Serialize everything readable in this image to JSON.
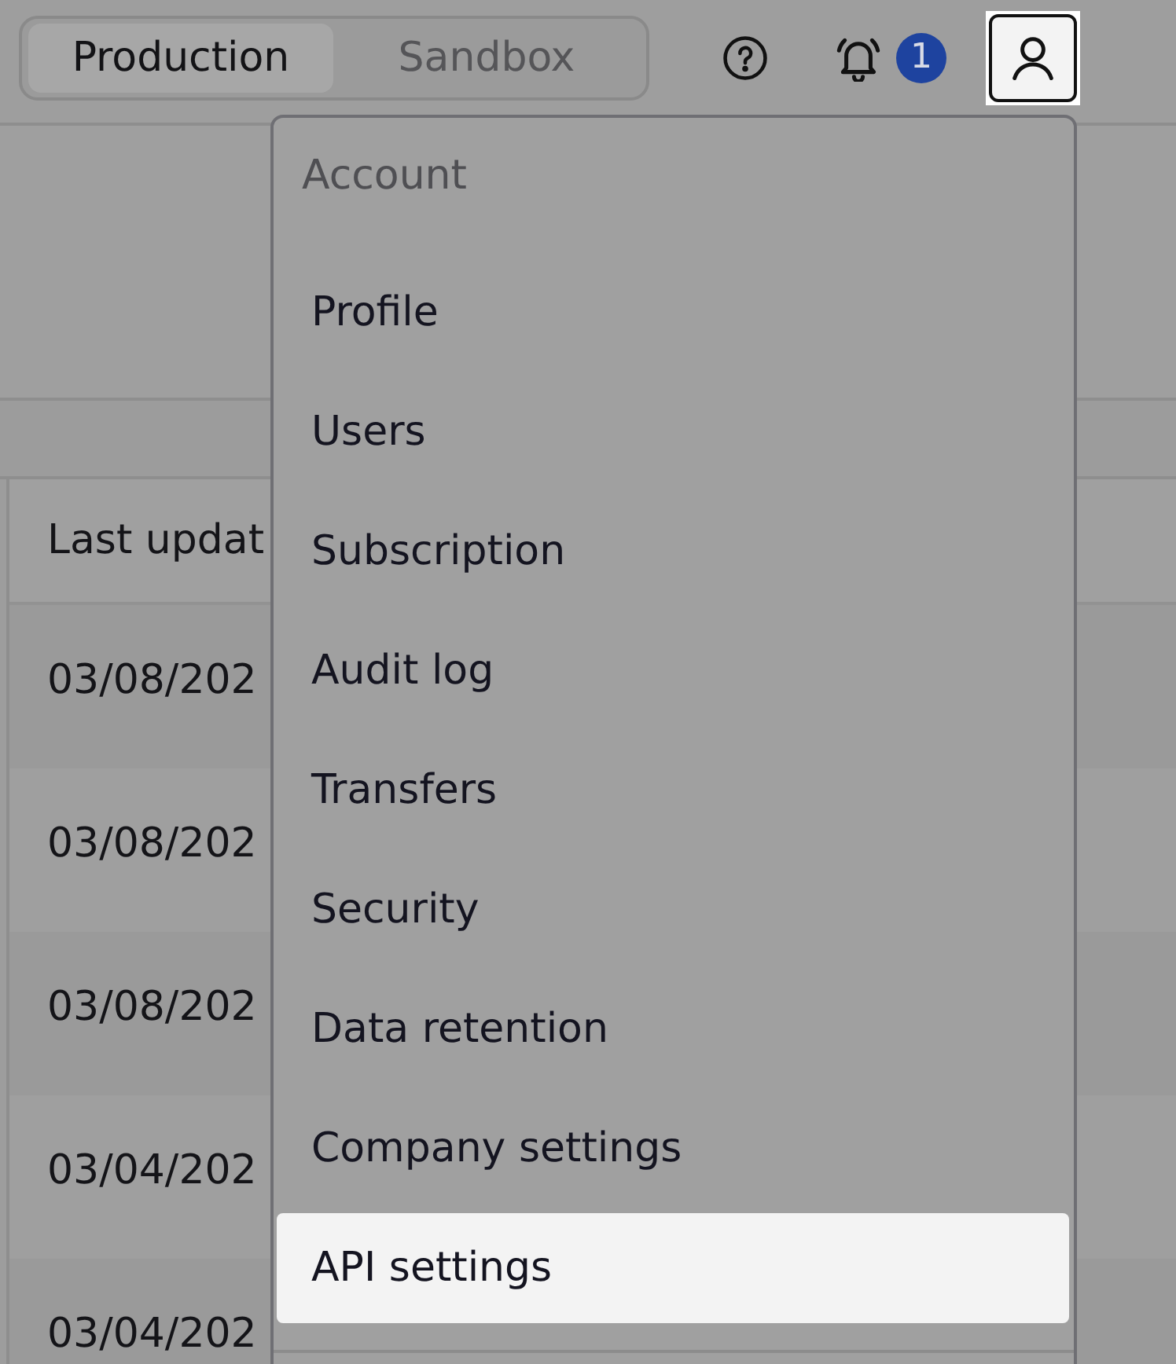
{
  "environment_tabs": [
    {
      "label": "Production",
      "selected": true
    },
    {
      "label": "Sandbox",
      "selected": false
    }
  ],
  "notifications": {
    "badge": "1"
  },
  "account_button": {
    "expanded": true
  },
  "table": {
    "columns": [
      "Last updat"
    ],
    "rows": [
      [
        "03/08/202"
      ],
      [
        "03/08/202"
      ],
      [
        "03/08/202"
      ],
      [
        "03/04/202"
      ],
      [
        "03/04/202"
      ]
    ]
  },
  "account_menu": {
    "heading": "Account",
    "items": [
      {
        "label": "Profile",
        "selected": false
      },
      {
        "label": "Users",
        "selected": false
      },
      {
        "label": "Subscription",
        "selected": false
      },
      {
        "label": "Audit log",
        "selected": false
      },
      {
        "label": "Transfers",
        "selected": false
      },
      {
        "label": "Security",
        "selected": false
      },
      {
        "label": "Data retention",
        "selected": false
      },
      {
        "label": "Company settings",
        "selected": false
      },
      {
        "label": "API settings",
        "selected": true
      }
    ]
  }
}
